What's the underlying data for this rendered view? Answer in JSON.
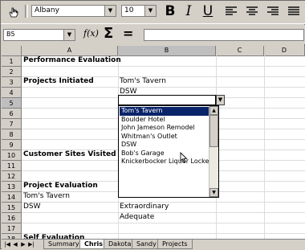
{
  "toolbar": {
    "font_name": "Albany",
    "font_size": "10",
    "bold_label": "B",
    "italic_label": "I",
    "underline_label": "U"
  },
  "formula_bar": {
    "name_box": "B5",
    "function_wizard_label": "f(x)",
    "sum_label": "Σ",
    "equals_label": "=",
    "input_value": ""
  },
  "columns": [
    "A",
    "B",
    "C",
    "D"
  ],
  "rows": [
    "1",
    "2",
    "3",
    "4",
    "5",
    "6",
    "7",
    "8",
    "9",
    "10",
    "11",
    "12",
    "13",
    "14",
    "15",
    "16",
    "17",
    "18"
  ],
  "cells": {
    "a1": "Performance Evaluation",
    "a3": "Projects Initiated",
    "b3": "Tom's Tavern",
    "b4": "DSW",
    "a10": "Customer Sites Visited",
    "a13": "Project Evaluation",
    "a14": "Tom's Tavern",
    "a15": "DSW",
    "b15": "Extraordinary",
    "b16": "Adequate",
    "a18": "Self Evaluation"
  },
  "dropdown": {
    "items": [
      "Tom's Tavern",
      "Boulder Hotel",
      "John Jameson Remodel",
      "Whitman's Outlet",
      "DSW",
      "Bob's Garage",
      "Knickerbocker Liquor Locker"
    ],
    "selected_index": 0
  },
  "sheet_tabs": [
    "Summary",
    "Chris",
    "Dakota",
    "Sandy",
    "Projects"
  ],
  "active_tab": "Chris"
}
